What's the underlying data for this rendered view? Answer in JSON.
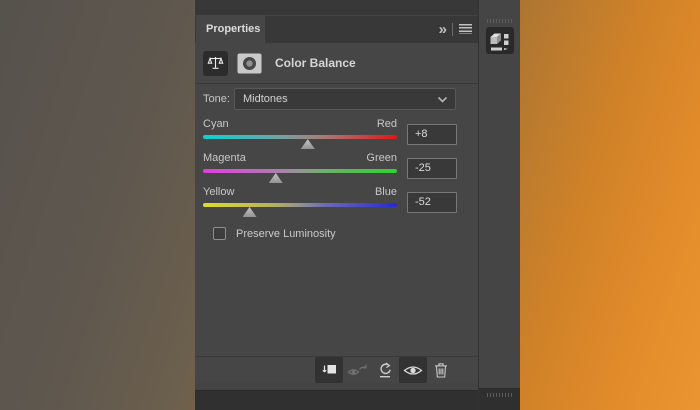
{
  "panel": {
    "tab_label": "Properties",
    "tab_icons": [
      {
        "name": "double-chevron-collapse-icon",
        "glyph": "»"
      },
      {
        "name": "panel-menu-icon"
      }
    ],
    "adjustment": {
      "icon": "color-balance-scales-icon",
      "mask_icon": "layer-mask-thumbnail-icon",
      "title": "Color Balance"
    },
    "tone": {
      "label": "Tone:",
      "selected": "Midtones",
      "chevron_icon": "chevron-down-icon"
    },
    "slider_range": {
      "min": -100,
      "max": 100
    },
    "sliders": [
      {
        "left_label": "Cyan",
        "right_label": "Red",
        "value": 8,
        "display_value": "+8",
        "gradient": "cyan-red"
      },
      {
        "left_label": "Magenta",
        "right_label": "Green",
        "value": -25,
        "display_value": "-25",
        "gradient": "magenta-green"
      },
      {
        "left_label": "Yellow",
        "right_label": "Blue",
        "value": -52,
        "display_value": "-52",
        "gradient": "yellow-blue"
      }
    ],
    "preserve_luminosity": {
      "label": "Preserve Luminosity",
      "checked": false
    },
    "footer": [
      {
        "name": "clip-to-layer-icon",
        "state": "active"
      },
      {
        "name": "view-previous-state-icon",
        "state": "disabled"
      },
      {
        "name": "reset-icon",
        "state": "normal"
      },
      {
        "name": "toggle-visibility-eye-icon",
        "state": "active"
      },
      {
        "name": "delete-adjustment-trash-icon",
        "state": "normal"
      }
    ]
  },
  "dock": {
    "collapsed_panel_icon": "3d-cube-panel-icon"
  },
  "colors": {
    "panel_bg": "#464646",
    "tab_bar_bg": "#383838",
    "control_bg": "#393939",
    "label_text": "#c6c6c6",
    "title_text": "#d6d6d6",
    "canvas_orange": "#e2892b",
    "canvas_gray": "#59554f",
    "slider_cyan": "#0bd2d2",
    "slider_red": "#df1717",
    "slider_magenta": "#e23ce2",
    "slider_green": "#2ed42e",
    "slider_yellow": "#dede2a",
    "slider_blue": "#2828d6"
  }
}
